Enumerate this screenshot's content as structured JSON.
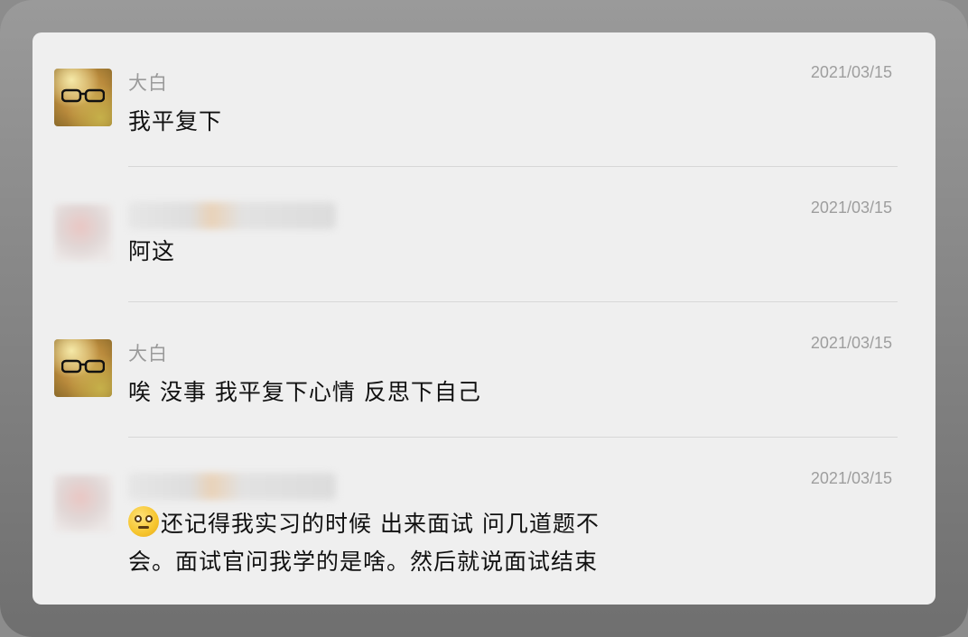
{
  "messages": [
    {
      "sender": "大白",
      "date": "2021/03/15",
      "text": "我平复下",
      "avatar": "dabai-avatar"
    },
    {
      "sender": "",
      "date": "2021/03/15",
      "text": "阿这",
      "avatar": "blurred-avatar"
    },
    {
      "sender": "大白",
      "date": "2021/03/15",
      "text": "唉 没事 我平复下心情 反思下自己",
      "avatar": "dabai-avatar"
    },
    {
      "sender": "",
      "date": "2021/03/15",
      "text_line1": "还记得我实习的时候  出来面试  问几道题不",
      "text_line2": "会。面试官问我学的是啥。然后就说面试结束",
      "emoji": "flushed-face-emoji",
      "avatar": "blurred-avatar"
    }
  ],
  "colors": {
    "card_bg": "#efefef",
    "name": "#9a9a9a",
    "date": "#9e9e9e",
    "text": "#111111",
    "divider": "#d7d7d7"
  }
}
